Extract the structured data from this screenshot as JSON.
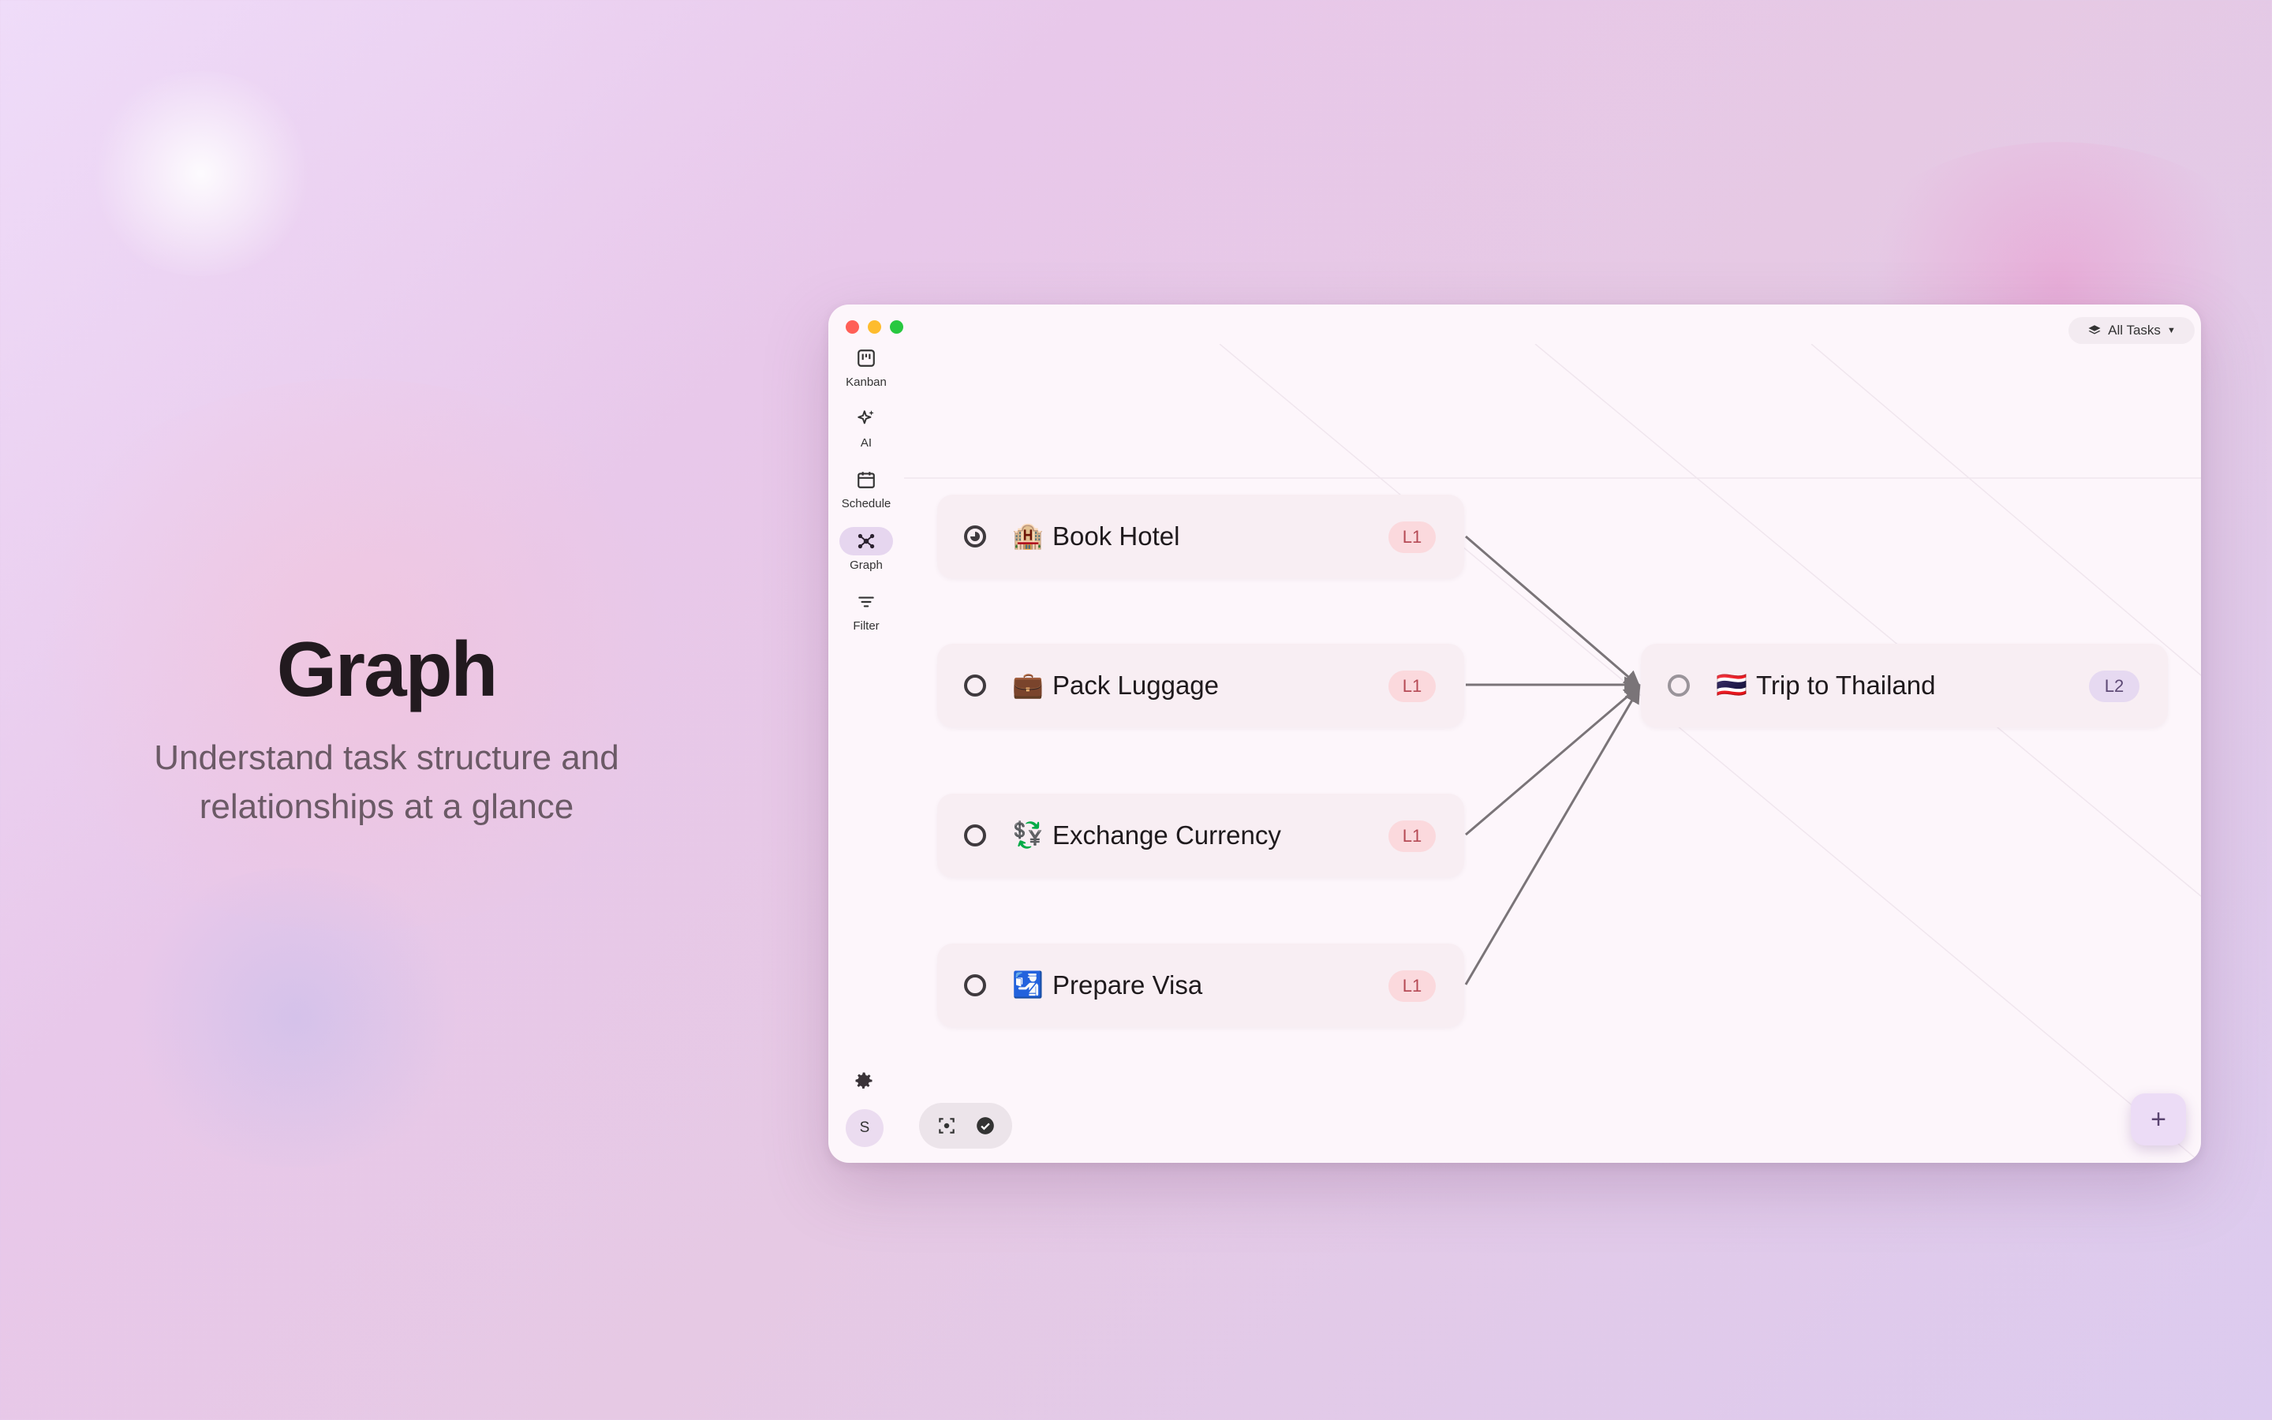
{
  "hero": {
    "title": "Graph",
    "subtitle": "Understand task structure and relationships at a glance"
  },
  "window": {
    "filter_dropdown": {
      "label": "All Tasks",
      "icon": "layers-icon"
    },
    "sidebar": {
      "items": [
        {
          "label": "Kanban",
          "icon": "kanban-icon",
          "active": false
        },
        {
          "label": "AI",
          "icon": "sparkles-icon",
          "active": false
        },
        {
          "label": "Schedule",
          "icon": "calendar-icon",
          "active": false
        },
        {
          "label": "Graph",
          "icon": "graph-icon",
          "active": true
        },
        {
          "label": "Filter",
          "icon": "filter-icon",
          "active": false
        }
      ],
      "settings_icon": "gear-icon",
      "avatar_initial": "S"
    },
    "graph": {
      "nodes": [
        {
          "id": "book-hotel",
          "emoji": "🏨",
          "label": "Book Hotel",
          "level": "L1",
          "status": "in-progress"
        },
        {
          "id": "pack-luggage",
          "emoji": "💼",
          "label": "Pack Luggage",
          "level": "L1",
          "status": "todo"
        },
        {
          "id": "exchange-currency",
          "emoji": "💱",
          "label": "Exchange Currency",
          "level": "L1",
          "status": "todo"
        },
        {
          "id": "prepare-visa",
          "emoji": "🛂",
          "label": "Prepare Visa",
          "level": "L1",
          "status": "todo"
        },
        {
          "id": "trip-to-thailand",
          "emoji": "🇹🇭",
          "label": "Trip to Thailand",
          "level": "L2",
          "status": "todo"
        }
      ],
      "edges": [
        {
          "from": "book-hotel",
          "to": "trip-to-thailand"
        },
        {
          "from": "pack-luggage",
          "to": "trip-to-thailand"
        },
        {
          "from": "exchange-currency",
          "to": "trip-to-thailand"
        },
        {
          "from": "prepare-visa",
          "to": "trip-to-thailand"
        }
      ]
    },
    "toolbar": {
      "focus_icon": "focus-frame-icon",
      "complete_icon": "check-circle-icon"
    },
    "add_button_label": "+",
    "colors": {
      "accent": "#e6d6ef",
      "badge_l1": "#fbd9dd",
      "badge_l2": "#e6d9f1",
      "edge": "#7a7478"
    }
  }
}
